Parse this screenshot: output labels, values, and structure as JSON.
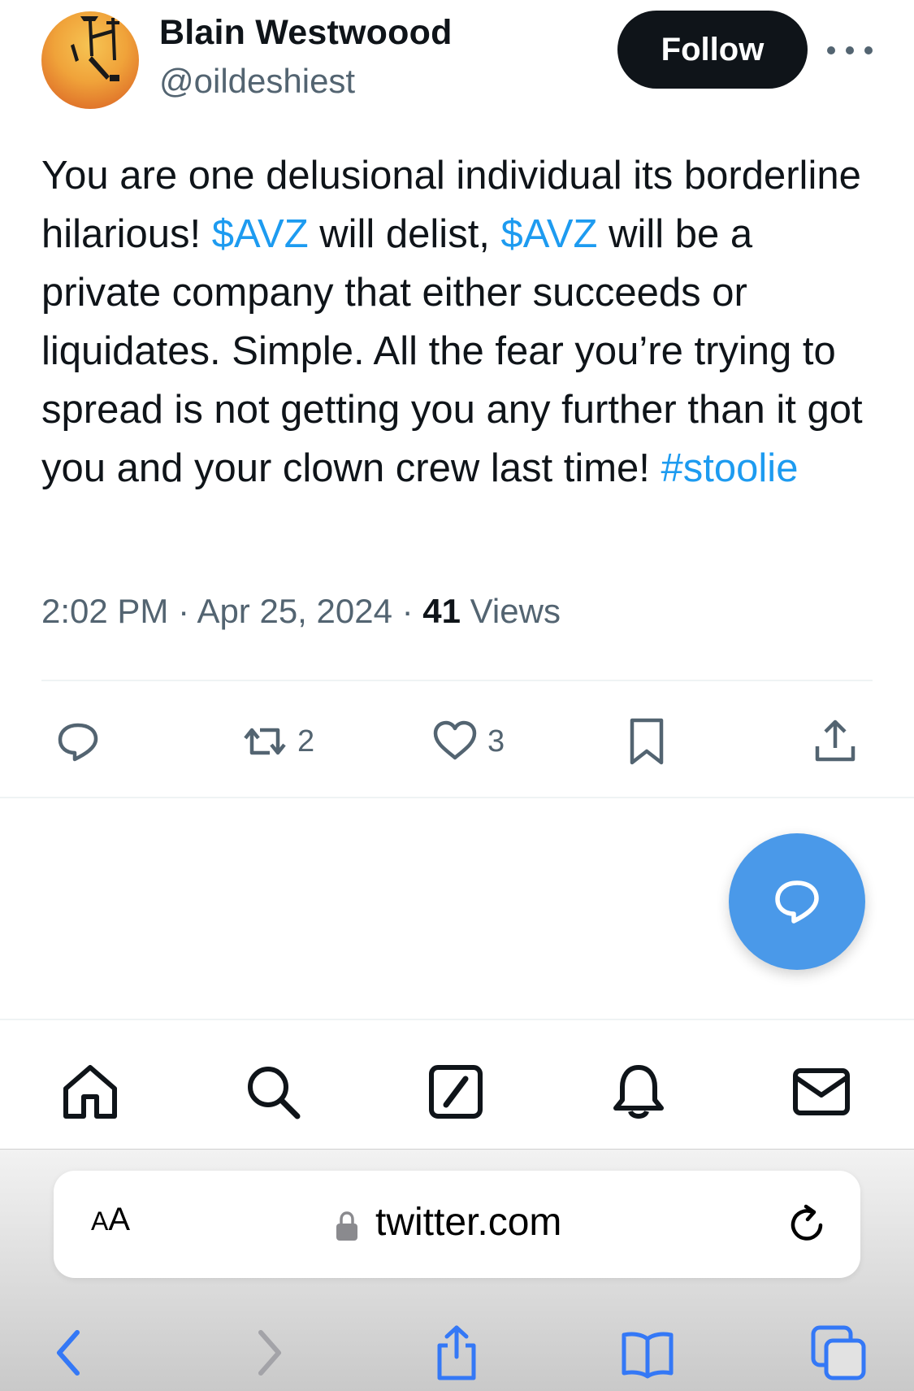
{
  "tweet": {
    "author": {
      "display_name": "Blain Westwoood",
      "handle": "@oildeshiest"
    },
    "follow_label": "Follow",
    "text_parts": [
      {
        "text": "You are one delusional individual its borderline hilarious! ",
        "link": false
      },
      {
        "text": "$AVZ",
        "link": true
      },
      {
        "text": " will delist, ",
        "link": false
      },
      {
        "text": "$AVZ",
        "link": true
      },
      {
        "text": " will be a private company that either succeeds or liquidates. Simple. All the fear you’re trying to spread is not getting you any further than it got you and your clown crew last time! ",
        "link": false
      },
      {
        "text": "#stoolie",
        "link": true
      }
    ],
    "time": "2:02 PM",
    "separator": " · ",
    "date": "Apr 25, 2024",
    "views_count": "41",
    "views_label": "Views"
  },
  "actions": {
    "reply_icon": "reply-icon",
    "retweet_count": "2",
    "like_count": "3",
    "bookmark_icon": "bookmark-icon",
    "share_icon": "share-icon"
  },
  "tabs": [
    "home-icon",
    "search-icon",
    "grok-icon",
    "notifications-icon",
    "messages-icon"
  ],
  "browser": {
    "aa_label_small": "A",
    "aa_label_big": "A",
    "url": "twitter.com"
  },
  "colors": {
    "link": "#1d9bf0",
    "follow_bg": "#0f1419",
    "fab": "#4a99e9",
    "safari_blue": "#3478f6",
    "secondary_text": "#536471"
  }
}
